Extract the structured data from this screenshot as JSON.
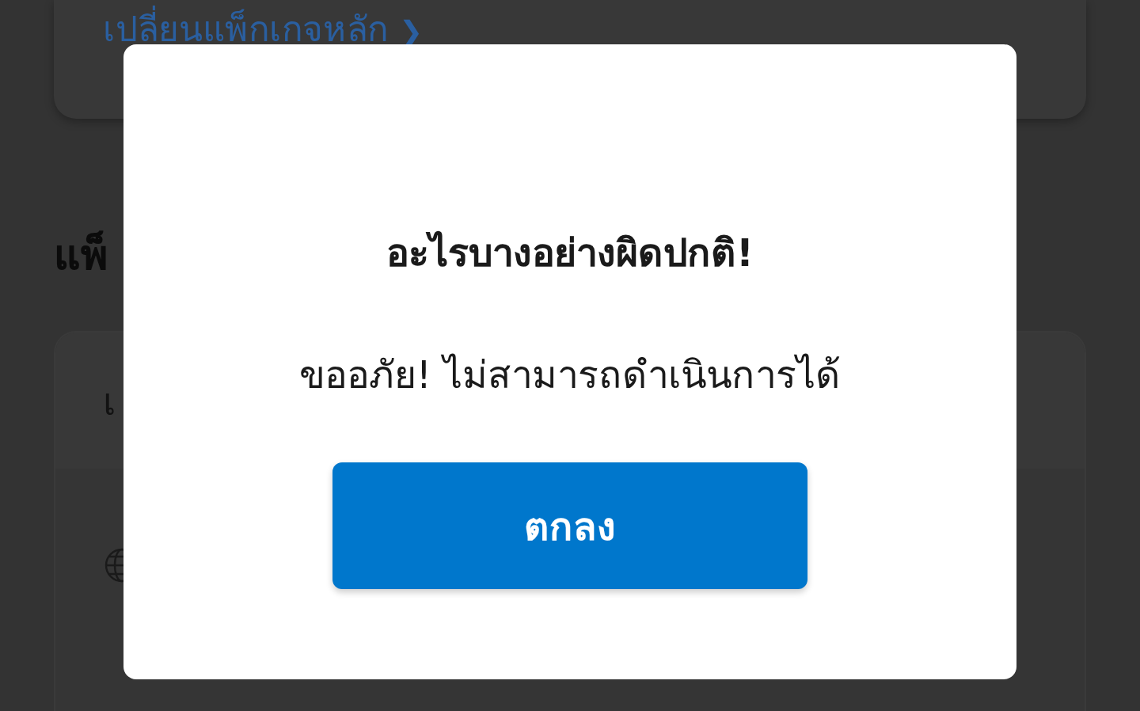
{
  "background": {
    "link": "เปลี่ยนแพ็กเกจหลัก",
    "link_arrow": "❯",
    "heading": "แพ็",
    "card_header": "เ"
  },
  "dialog": {
    "title": "อะไรบางอย่างผิดปกติ!",
    "message": "ขออภัย! ไม่สามารถดำเนินการได้",
    "button": "ตกลง"
  }
}
